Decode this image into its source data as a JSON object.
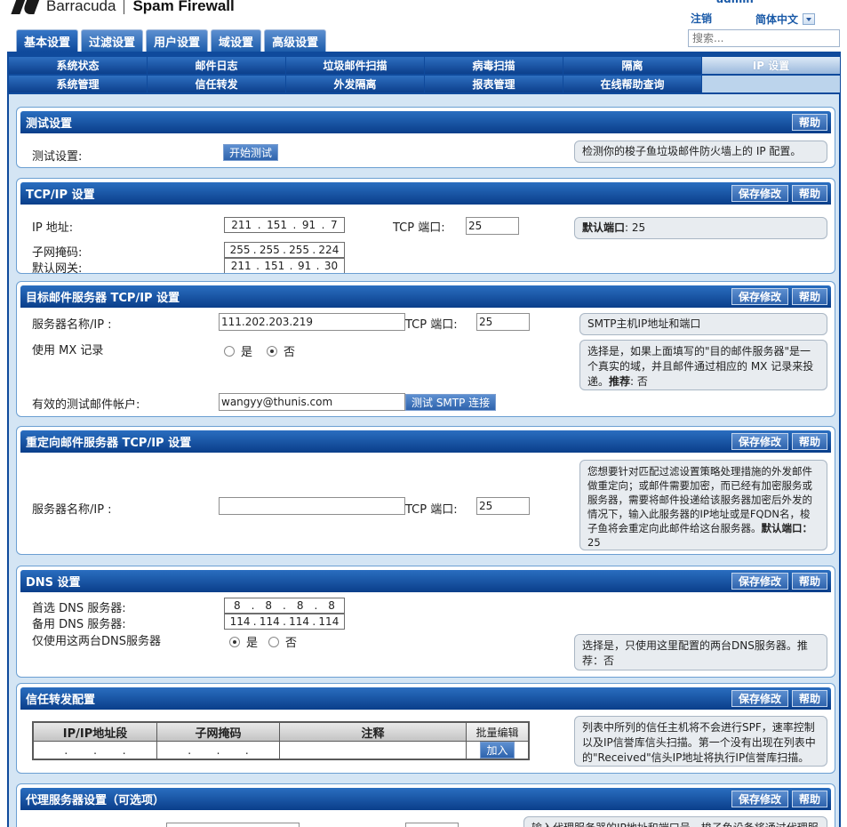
{
  "header": {
    "brand": "Barracuda",
    "product": "Spam Firewall",
    "partial_text": "admin",
    "logout": "注销",
    "language": "简体中文",
    "search_placeholder": "搜索..."
  },
  "main_tabs": [
    "基本设置",
    "过滤设置",
    "用户设置",
    "域设置",
    "高级设置"
  ],
  "subnav": {
    "row1": [
      "系统状态",
      "邮件日志",
      "垃圾邮件扫描",
      "病毒扫描",
      "隔离",
      "IP 设置"
    ],
    "row2": [
      "系统管理",
      "信任转发",
      "外发隔离",
      "报表管理",
      "在线帮助查询"
    ]
  },
  "buttons": {
    "save": "保存修改",
    "help": "帮助"
  },
  "test": {
    "title": "测试设置",
    "label": "测试设置:",
    "button": "开始测试",
    "help": "检测你的梭子鱼垃圾邮件防火墙上的 IP 配置。"
  },
  "tcpip": {
    "title": "TCP/IP 设置",
    "ip_label": "IP 地址:",
    "ip": [
      "211",
      "151",
      "91",
      "7"
    ],
    "port_label": "TCP 端口:",
    "port": "25",
    "mask_label": "子网掩码:",
    "mask": [
      "255",
      "255",
      "255",
      "224"
    ],
    "gw_label": "默认网关:",
    "gw": [
      "211",
      "151",
      "91",
      "30"
    ],
    "help_bold": "默认端口",
    "help_rest": ": 25"
  },
  "dest": {
    "title": "目标邮件服务器 TCP/IP 设置",
    "server_label": "服务器名称/IP :",
    "server": "111.202.203.219",
    "port_label": "TCP 端口:",
    "port": "25",
    "help1": "SMTP主机IP地址和端口",
    "mx_label": "使用 MX 记录",
    "yes": "是",
    "no": "否",
    "help2": "选择是，如果上面填写的\"目的邮件服务器\"是一个真实的域，并且邮件通过相应的 MX 记录来投递。",
    "help2_bold": "推荐",
    "help2_tail": ": 否",
    "account_label": "有效的测试邮件帐户:",
    "account": "wangyy@thunis.com",
    "smtp_button": "测试 SMTP 连接"
  },
  "redirect": {
    "title": "重定向邮件服务器 TCP/IP 设置",
    "server_label": "服务器名称/IP :",
    "server": "",
    "port_label": "TCP 端口:",
    "port": "25",
    "help": "您想要针对匹配过滤设置策略处理措施的外发邮件做重定向；或邮件需要加密，而已经有加密服务或服务器，需要将邮件投递给该服务器加密后外发的情况下，输入此服务器的IP地址或是FQDN名，梭子鱼将会重定向此邮件给这台服务器。",
    "help_bold": "默认端口：",
    "help_tail": "25"
  },
  "dns": {
    "title": "DNS 设置",
    "primary_label": "首选 DNS 服务器:",
    "primary": [
      "8",
      "8",
      "8",
      "8"
    ],
    "secondary_label": "备用 DNS 服务器:",
    "secondary": [
      "114",
      "114",
      "114",
      "114"
    ],
    "only_label": "仅使用这两台DNS服务器",
    "yes": "是",
    "no": "否",
    "help": "选择是，只使用这里配置的两台DNS服务器。推荐：否"
  },
  "trust": {
    "title": "信任转发配置",
    "columns": [
      "IP/IP地址段",
      "子网掩码",
      "注释"
    ],
    "batch_edit": "批量编辑",
    "add_button": "加入",
    "help": "列表中所列的信任主机将不会进行SPF，速率控制以及IP信誉库信头扫描。第一个没有出现在列表中的\"Received\"信头IP地址将执行IP信誉库扫描。"
  },
  "proxy": {
    "title": "代理服务器设置（可选项）",
    "help": "输入代理服务器的IP地址和端口号，梭子鱼设备将通过代理服务器连接"
  }
}
